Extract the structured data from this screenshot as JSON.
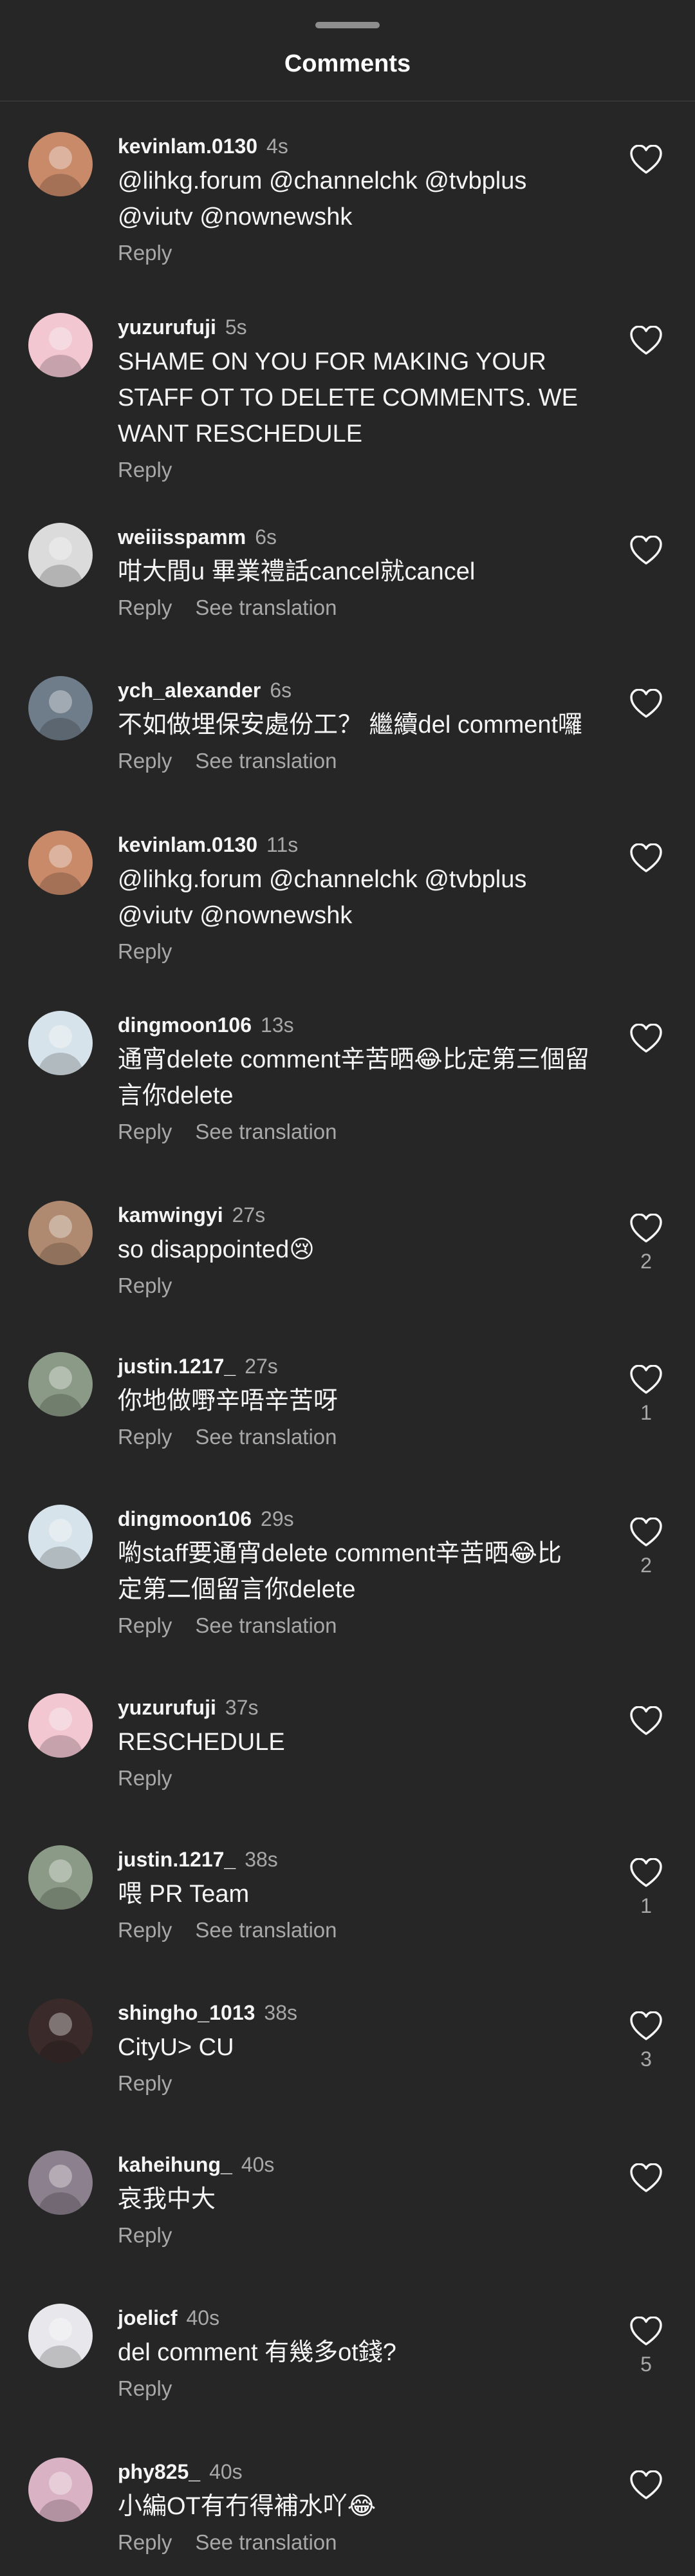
{
  "header": {
    "title": "Comments"
  },
  "colors": {
    "background": "#262626",
    "text": "#f5f5f5",
    "secondary": "#a8a8a8"
  },
  "actions": {
    "reply": "Reply",
    "translate": "See translation"
  },
  "comments": [
    {
      "username": "kevinlam.0130",
      "time": "4s",
      "text": "@lihkg.forum @channelchk @tvbplus\n@viutv @nownewshk",
      "translate": false,
      "likes": "",
      "avatar": "#c98a6a"
    },
    {
      "username": "yuzurufuji",
      "time": "5s",
      "text": "SHAME ON YOU FOR MAKING YOUR\nSTAFF OT TO DELETE COMMENTS. WE\nWANT RESCHEDULE",
      "translate": false,
      "likes": "",
      "avatar": "#f2c7d2"
    },
    {
      "username": "weiiisspamm",
      "time": "6s",
      "text": "咁大間u 畢業禮話cancel就cancel",
      "translate": true,
      "likes": "",
      "avatar": "#dbdbdb"
    },
    {
      "username": "ych_alexander",
      "time": "6s",
      "text": "不如做埋保安處份工？ 繼續del comment囉",
      "translate": true,
      "likes": "",
      "avatar": "#6f7d8a"
    },
    {
      "username": "kevinlam.0130",
      "time": "11s",
      "text": "@lihkg.forum @channelchk @tvbplus\n@viutv @nownewshk",
      "translate": false,
      "likes": "",
      "avatar": "#c98a6a"
    },
    {
      "username": "dingmoon106",
      "time": "13s",
      "text": "通宵delete comment辛苦晒😂比定第三個留\n言你delete",
      "translate": true,
      "likes": "",
      "avatar": "#d7e3ea"
    },
    {
      "username": "kamwingyi",
      "time": "27s",
      "text": "so disappointed😢",
      "translate": false,
      "likes": "2",
      "avatar": "#b08a70"
    },
    {
      "username": "justin.1217_",
      "time": "27s",
      "text": "你地做嘢辛唔辛苦呀",
      "translate": true,
      "likes": "1",
      "avatar": "#8a9a86"
    },
    {
      "username": "dingmoon106",
      "time": "29s",
      "text": "喲staff要通宵delete comment辛苦晒😂比\n定第二個留言你delete",
      "translate": true,
      "likes": "2",
      "avatar": "#d7e3ea"
    },
    {
      "username": "yuzurufuji",
      "time": "37s",
      "text": "RESCHEDULE",
      "translate": false,
      "likes": "",
      "avatar": "#f2c7d2"
    },
    {
      "username": "justin.1217_",
      "time": "38s",
      "text": "喂 PR Team",
      "translate": true,
      "likes": "1",
      "avatar": "#8a9a86"
    },
    {
      "username": "shingho_1013",
      "time": "38s",
      "text": "CityU> CU",
      "translate": false,
      "likes": "3",
      "avatar": "#3a2a2a"
    },
    {
      "username": "kaheihung_",
      "time": "40s",
      "text": "哀我中大",
      "translate": false,
      "likes": "",
      "avatar": "#8c7f8e"
    },
    {
      "username": "joelicf",
      "time": "40s",
      "text": "del comment 有幾多ot錢?",
      "translate": false,
      "likes": "5",
      "avatar": "#e8e8ec"
    },
    {
      "username": "phy825_",
      "time": "40s",
      "text": "小編OT有冇得補水吖😂",
      "translate": true,
      "likes": "",
      "avatar": "#d9b3c4"
    }
  ]
}
